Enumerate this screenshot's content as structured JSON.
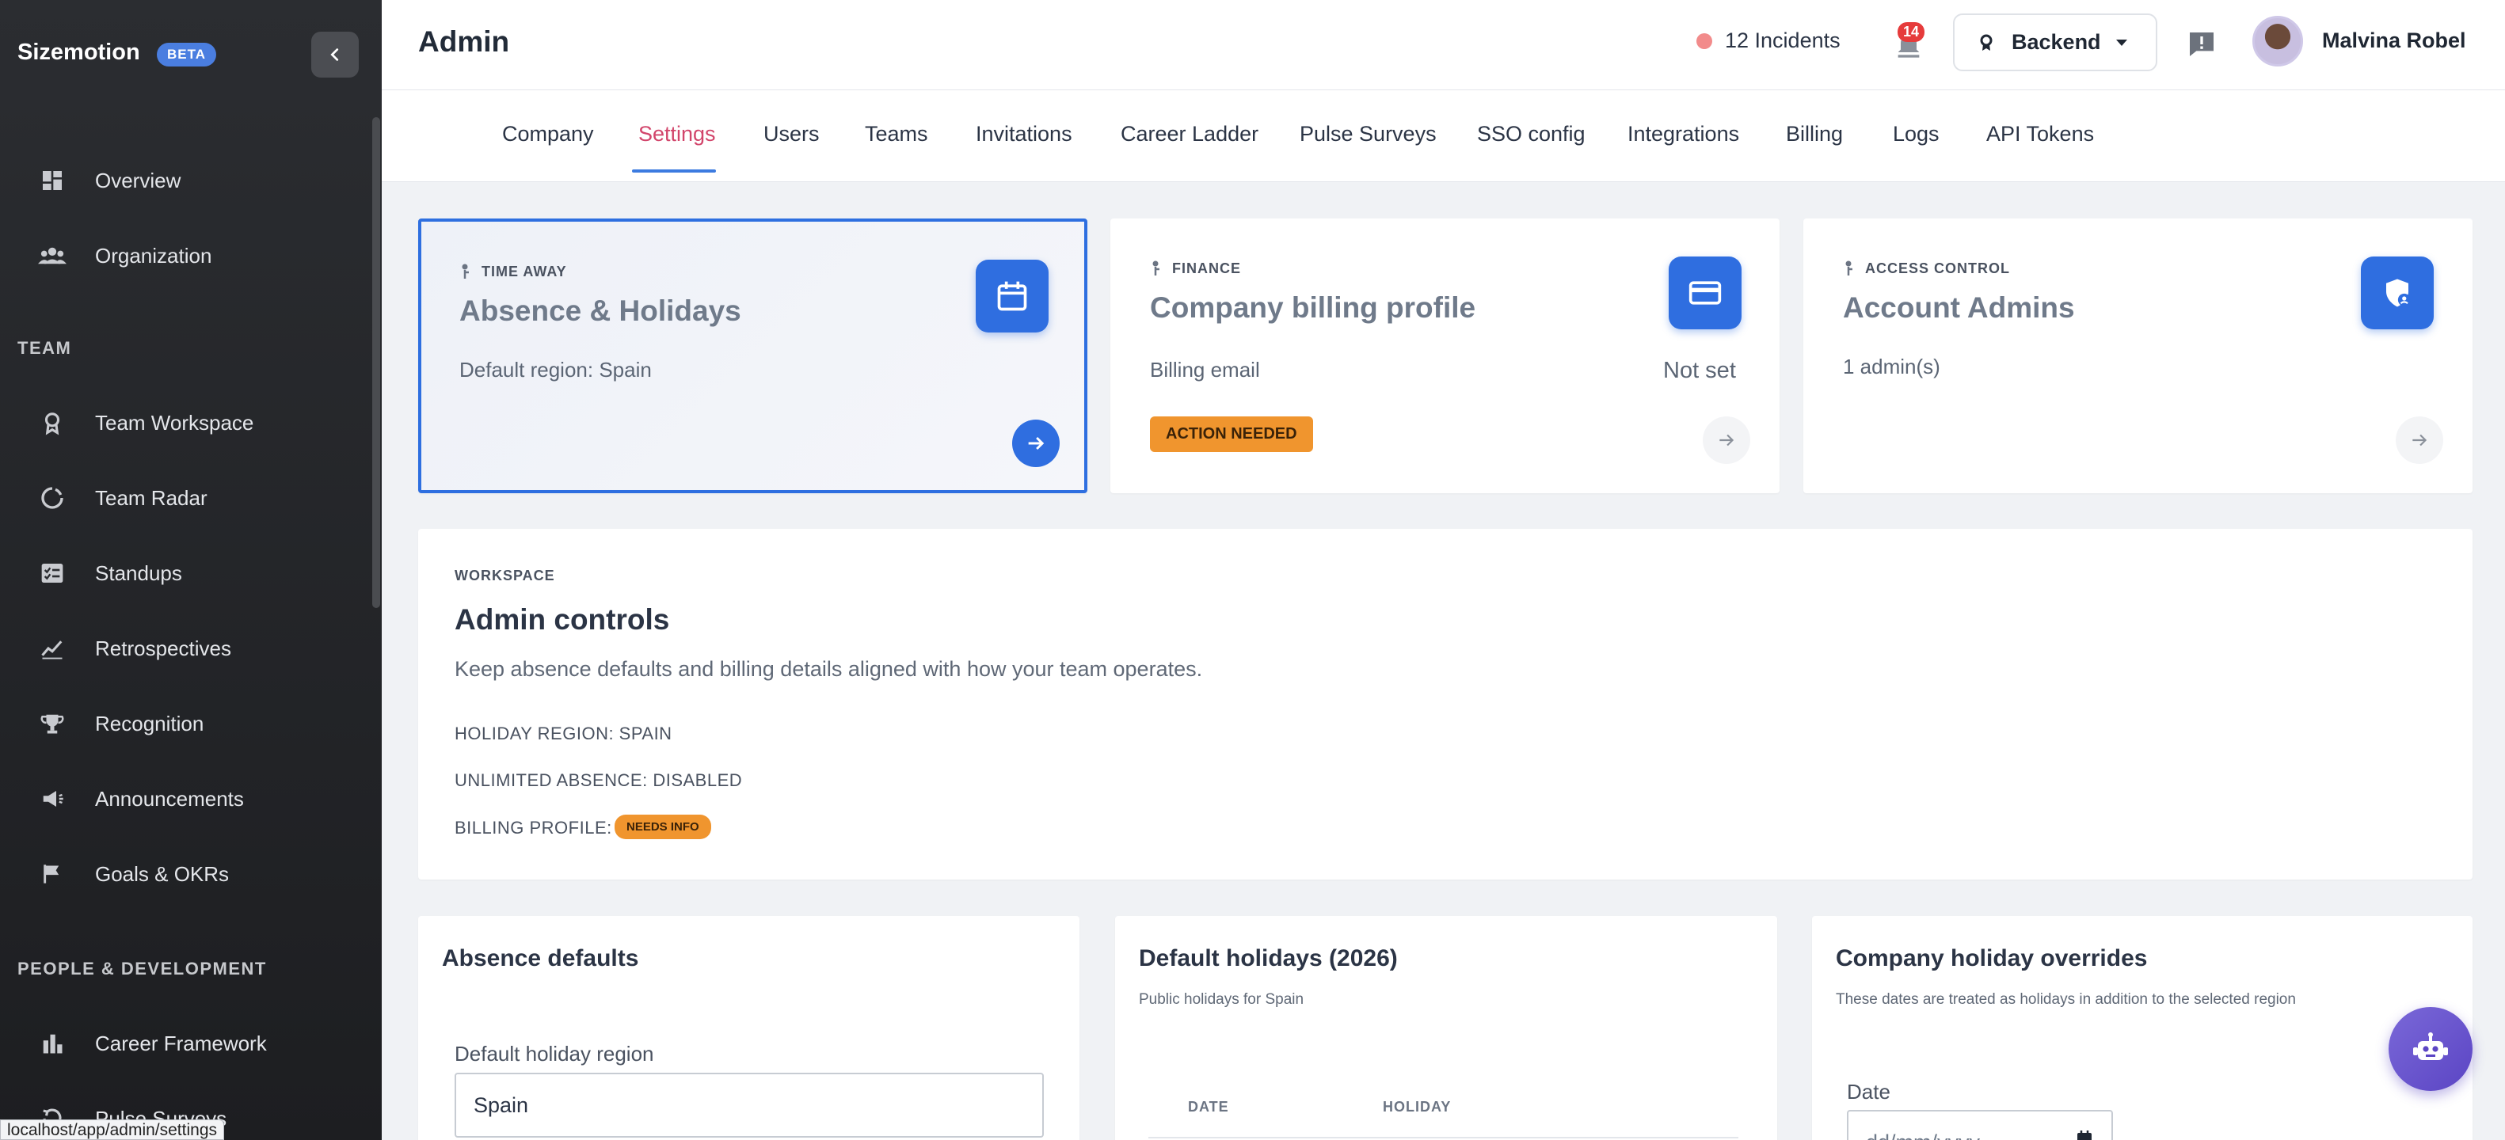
{
  "sidebar": {
    "brand": "Sizemotion",
    "beta": "BETA",
    "items_top": [
      {
        "label": "Overview",
        "icon": "dashboard-icon"
      },
      {
        "label": "Organization",
        "icon": "people-icon"
      }
    ],
    "team_section": "TEAM",
    "team_items": [
      {
        "label": "Team Workspace",
        "icon": "badge-icon"
      },
      {
        "label": "Team Radar",
        "icon": "radar-icon"
      },
      {
        "label": "Standups",
        "icon": "checklist-icon"
      },
      {
        "label": "Retrospectives",
        "icon": "trend-icon"
      },
      {
        "label": "Recognition",
        "icon": "trophy-icon"
      },
      {
        "label": "Announcements",
        "icon": "megaphone-icon"
      },
      {
        "label": "Goals & OKRs",
        "icon": "flag-icon"
      }
    ],
    "people_section": "PEOPLE & DEVELOPMENT",
    "people_items": [
      {
        "label": "Career Framework",
        "icon": "bar-chart-icon"
      },
      {
        "label": "Pulse Surveys",
        "icon": "history-icon"
      }
    ],
    "status_url": "localhost/app/admin/settings"
  },
  "header": {
    "title": "Admin",
    "incidents": "12 Incidents",
    "notifications_count": "14",
    "team_selector": "Backend",
    "user_name": "Malvina Robel"
  },
  "tabs": [
    "Company",
    "Settings",
    "Users",
    "Teams",
    "Invitations",
    "Career Ladder",
    "Pulse Surveys",
    "SSO config",
    "Integrations",
    "Billing",
    "Logs",
    "API Tokens"
  ],
  "active_tab": "Settings",
  "cards": {
    "time_away": {
      "overline": "TIME AWAY",
      "title": "Absence & Holidays",
      "subtitle": "Default region: Spain"
    },
    "finance": {
      "overline": "FINANCE",
      "title": "Company billing profile",
      "field": "Billing email",
      "value": "Not set",
      "badge": "ACTION NEEDED"
    },
    "access": {
      "overline": "ACCESS CONTROL",
      "title": "Account Admins",
      "subtitle": "1 admin(s)"
    }
  },
  "workspace": {
    "overline": "WORKSPACE",
    "title": "Admin controls",
    "description": "Keep absence defaults and billing details aligned with how your team operates.",
    "line1": "HOLIDAY REGION: SPAIN",
    "line2": "UNLIMITED ABSENCE: DISABLED",
    "line3": "BILLING PROFILE:",
    "line3_badge": "NEEDS INFO"
  },
  "panels": {
    "absence": {
      "title": "Absence defaults",
      "field_label": "Default holiday region",
      "field_value": "Spain"
    },
    "holidays": {
      "title": "Default holidays (2026)",
      "subtitle": "Public holidays for Spain",
      "col_date": "DATE",
      "col_holiday": "HOLIDAY"
    },
    "overrides": {
      "title": "Company holiday overrides",
      "subtitle": "These dates are treated as holidays in addition to the selected region",
      "date_label": "Date",
      "date_placeholder": "dd/mm/yyyy"
    }
  },
  "colors": {
    "primary": "#2f6ee0",
    "active_tab": "#d2456b",
    "warning": "#f0952e",
    "sidebar_bg": "#2b2d31"
  }
}
